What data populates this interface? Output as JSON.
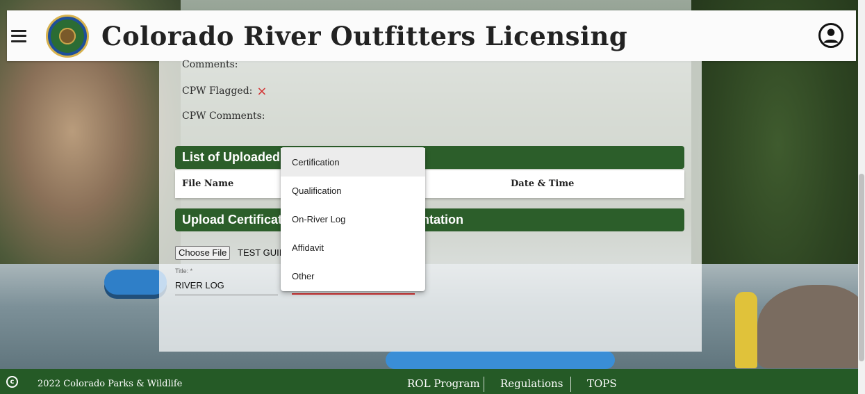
{
  "header": {
    "title": "Colorado River Outfitters Licensing",
    "logo_text": "COLORADO PARKS & WILDLIFE"
  },
  "fields": {
    "comments_label": "Comments:",
    "cpw_flagged_label": "CPW Flagged:",
    "cpw_flagged_value": "×",
    "cpw_comments_label": "CPW Comments:"
  },
  "uploaded_section": {
    "title": "List of Uploaded",
    "columns": [
      "File Name",
      "Date & Time"
    ]
  },
  "upload_section": {
    "title_prefix": "Upload Certificat",
    "title_suffix": "entation",
    "choose_file_label": "Choose File",
    "file_name": "TEST GUII",
    "title_field_label": "Title: *",
    "title_field_value": "RIVER LOG"
  },
  "dropdown": {
    "options": [
      "Certification",
      "Qualification",
      "On-River Log",
      "Affidavit",
      "Other"
    ],
    "highlighted": "Certification"
  },
  "footer": {
    "copyright_symbol": "c",
    "copyright": "2022 Colorado Parks & Wildlife",
    "links": [
      "ROL Program",
      "Regulations",
      "TOPS"
    ]
  },
  "colors": {
    "brand_green": "#2c5e2a",
    "footer_green": "#255a26",
    "error_red": "#d32f2f"
  }
}
